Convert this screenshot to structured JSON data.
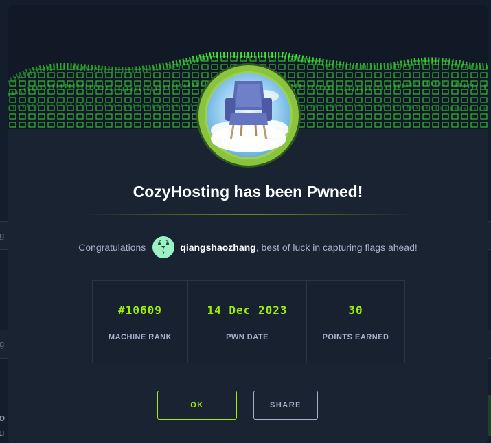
{
  "modal": {
    "title": "CozyHosting has been Pwned!",
    "congrats_prefix": "Congratulations",
    "username": "qiangshaozhang",
    "congrats_suffix": ", best of luck in capturing flags ahead!",
    "stats": [
      {
        "value": "#10609",
        "label": "MACHINE RANK"
      },
      {
        "value": "14 Dec 2023",
        "label": "PWN DATE"
      },
      {
        "value": "30",
        "label": "POINTS EARNED"
      }
    ],
    "buttons": {
      "ok": "OK",
      "share": "SHARE"
    }
  },
  "background": {
    "field1_fragment": "g",
    "field2_fragment": "g",
    "bottom_fragment_1": "o",
    "bottom_fragment_2": "u"
  },
  "colors": {
    "accent": "#9fef00",
    "modal_bg": "#1a2332",
    "text_muted": "#a4b1cd",
    "badge_ring": "#8ac43f"
  },
  "icons": {
    "hero": "green-particle-wave",
    "badge": "armchair-in-clouds",
    "avatar": "robot-face-avatar"
  }
}
